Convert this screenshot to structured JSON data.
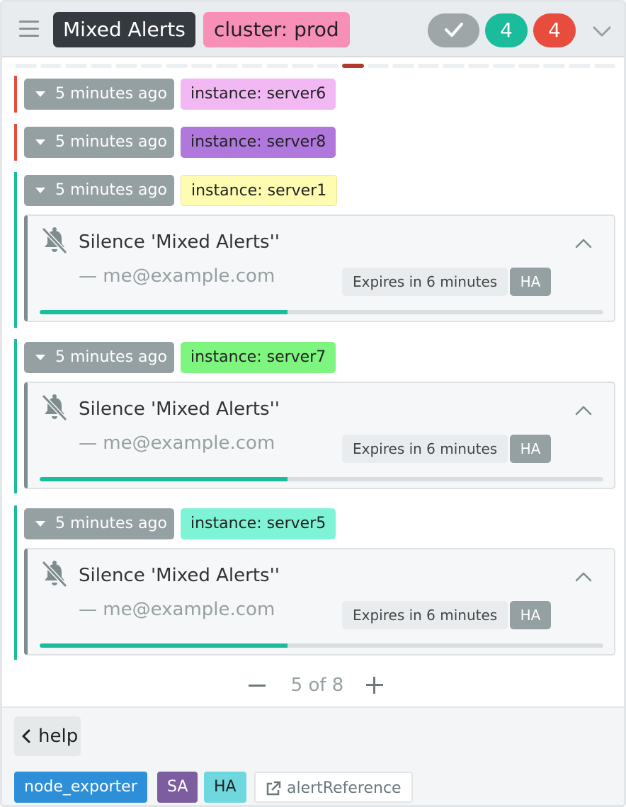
{
  "header": {
    "title": "Mixed Alerts",
    "label": "cluster: prod",
    "silenced_count": "",
    "inhibited_count": "4",
    "active_count": "4",
    "colors": {
      "title_bg": "#343a40",
      "label_bg": "#f78fb7",
      "green": "#1abc9c",
      "red": "#e74c3c"
    },
    "icons": {
      "menu": "hamburger-icon",
      "check": "check-icon",
      "collapse": "chevron-down-icon"
    }
  },
  "pager_dashes": {
    "total": 24,
    "active_index": 13
  },
  "alerts": [
    {
      "time": "5 minutes ago",
      "label": "instance: server6",
      "state_color": "#e74c3c",
      "label_color": "#f1b8f3"
    },
    {
      "time": "5 minutes ago",
      "label": "instance: server8",
      "state_color": "#e74c3c",
      "label_color": "#b077dd"
    },
    {
      "time": "5 minutes ago",
      "label": "instance: server1",
      "state_color": "#1abc9c",
      "label_color": "#fdfcb0",
      "silence": {
        "title": "Silence 'Mixed Alerts''",
        "author": "— me@example.com",
        "expires": "Expires in 6 minutes",
        "cluster": "HA",
        "progress": 0.44
      }
    },
    {
      "time": "5 minutes ago",
      "label": "instance: server7",
      "state_color": "#1abc9c",
      "label_color": "#7ef57e",
      "silence": {
        "title": "Silence 'Mixed Alerts''",
        "author": "— me@example.com",
        "expires": "Expires in 6 minutes",
        "cluster": "HA",
        "progress": 0.44
      }
    },
    {
      "time": "5 minutes ago",
      "label": "instance: server5",
      "state_color": "#1abc9c",
      "label_color": "#7ff3d6",
      "silence": {
        "title": "Silence 'Mixed Alerts''",
        "author": "— me@example.com",
        "expires": "Expires in 6 minutes",
        "cluster": "HA",
        "progress": 0.44
      }
    }
  ],
  "group_pager": {
    "text": "5 of 8"
  },
  "footer": {
    "help": "help",
    "tags": {
      "receiver": "node_exporter",
      "sa": "SA",
      "ha": "HA",
      "link": "alertReference"
    },
    "tag_colors": {
      "receiver": "#2d8fd8",
      "sa": "#7c5ea0",
      "ha": "#6fd8de"
    }
  }
}
